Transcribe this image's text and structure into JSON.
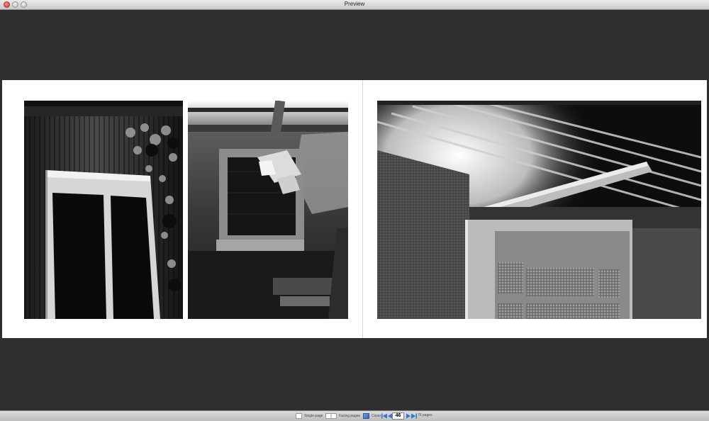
{
  "window": {
    "title": "Preview"
  },
  "footer": {
    "single_label": "Single page",
    "facing_label": "Facing pages",
    "cover_label": "Cover",
    "current_page": "46",
    "total_pages": "76 pages"
  },
  "icons": {
    "close": "close-icon",
    "minimize": "minimize-icon",
    "maximize": "maximize-icon",
    "first": "first-page-icon",
    "prev": "previous-page-icon",
    "next": "next-page-icon",
    "last": "last-page-icon"
  },
  "colors": {
    "nav_arrow": "#2f78d0",
    "window_bg": "#2f2f2f"
  }
}
